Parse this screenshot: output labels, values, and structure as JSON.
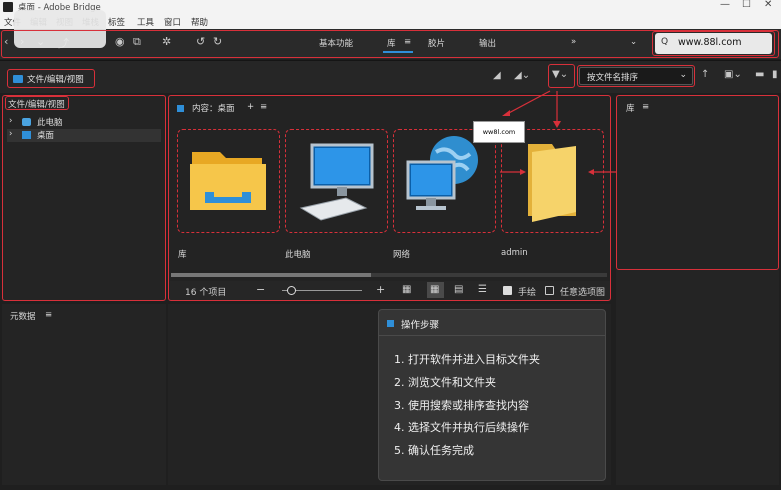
{
  "titlebar": {
    "title": "桌面 - Adobe Bridge",
    "minimize": "—",
    "maximize": "☐",
    "close": "✕"
  },
  "menu": [
    "文件",
    "编辑",
    "视图",
    "堆栈",
    "标签",
    "工具",
    "窗口",
    "帮助"
  ],
  "workspaces": {
    "essentials": "基本功能",
    "library": "库",
    "library_menu": "≡",
    "filmstrip": "胶片",
    "output": "输出",
    "more": "»",
    "dropdown": "⌄"
  },
  "search": {
    "value": "www.88l.com"
  },
  "path": {
    "crumb": "文件/编辑/视图"
  },
  "sort": {
    "label": "按文件名排序"
  },
  "folders_panel": {
    "title": "文件/编辑/视图",
    "items": [
      {
        "label": "此电脑"
      },
      {
        "label": "桌面"
      }
    ]
  },
  "content_panel": {
    "title": "内容：桌面",
    "add": "+",
    "menu": "≡",
    "items": [
      {
        "label": "库"
      },
      {
        "label": "此电脑"
      },
      {
        "label": "网络"
      },
      {
        "label": "admin"
      }
    ],
    "status": {
      "count": "16 个项目",
      "zoom_minus": "−",
      "zoom_plus": "+",
      "handwriting": "手绘",
      "unrestricted": "任意选项图"
    }
  },
  "preview_panel": {
    "title": "库",
    "menu": "≡"
  },
  "metadata_panel": {
    "title": "元数据",
    "menu": "≡"
  },
  "steps_card": {
    "title": "操作步骤",
    "steps": [
      "1. 打开软件并进入目标文件夹",
      "2. 浏览文件和文件夹",
      "3. 使用搜索或排序查找内容",
      "4. 选择文件并执行后续操作",
      "5. 确认任务完成"
    ]
  },
  "watermark": "ww8l.com",
  "colors": {
    "accent": "#2f8fd8",
    "highlight": "#d8303a",
    "background": "#1f1f1f"
  }
}
